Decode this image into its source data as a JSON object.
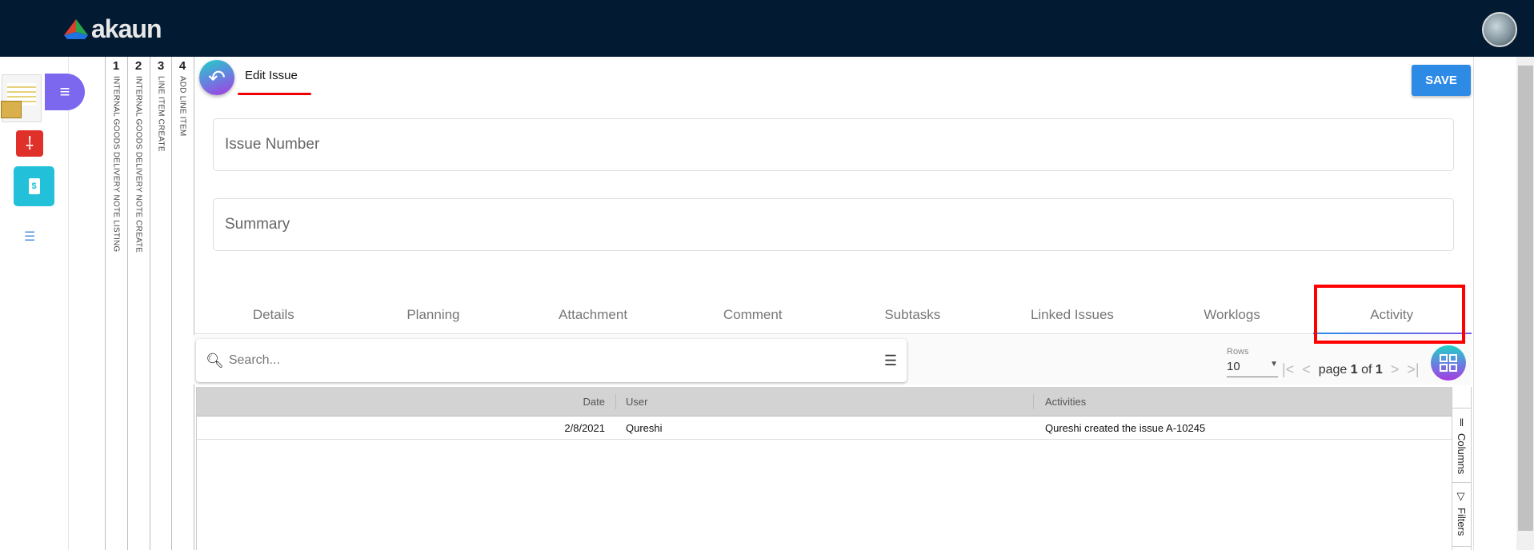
{
  "header": {
    "logo": "akaun"
  },
  "vertical_tabs": [
    {
      "num": "1",
      "label": "INTERNAL GOODS DELIVERY NOTE LISTING"
    },
    {
      "num": "2",
      "label": "INTERNAL GOODS DELIVERY NOTE CREATE"
    },
    {
      "num": "3",
      "label": "LINE ITEM CREATE"
    },
    {
      "num": "4",
      "label": "ADD LINE ITEM"
    }
  ],
  "page": {
    "title": "Edit Issue",
    "save_label": "SAVE",
    "issue_number_placeholder": "Issue Number",
    "summary_placeholder": "Summary"
  },
  "tabs": [
    "Details",
    "Planning",
    "Attachment",
    "Comment",
    "Subtasks",
    "Linked Issues",
    "Worklogs",
    "Activity"
  ],
  "active_tab": "Activity",
  "toolbar": {
    "search_placeholder": "Search...",
    "rows_label": "Rows",
    "rows_value": "10",
    "page_word": "page",
    "page": "1",
    "of_word": "of",
    "total_pages": "1"
  },
  "grid": {
    "columns": [
      "Date",
      "User",
      "Activities"
    ],
    "rows": [
      {
        "date": "2/8/2021",
        "user": "Qureshi",
        "activity": "Qureshi created the issue A-10245"
      }
    ]
  },
  "side_panel": {
    "columns": "Columns",
    "filters": "Filters"
  }
}
